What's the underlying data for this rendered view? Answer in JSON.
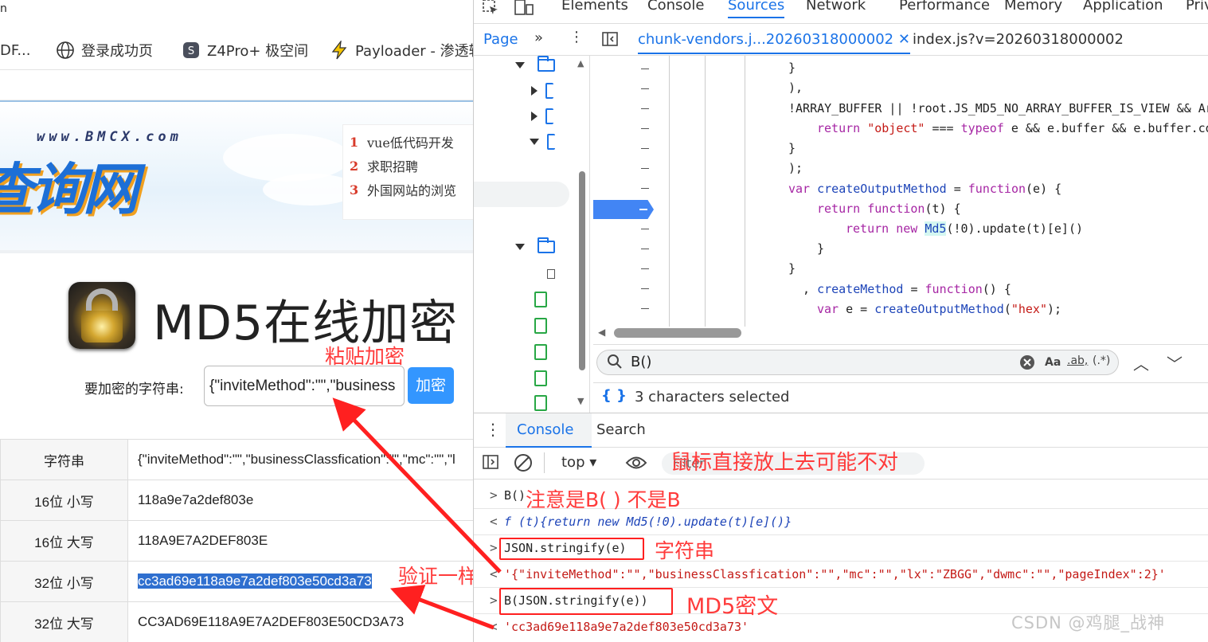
{
  "browser": {
    "top_fragment": "n",
    "bookmarks": [
      {
        "label": "DF...",
        "icon": "none"
      },
      {
        "label": "登录成功页",
        "icon": "globe-icon"
      },
      {
        "label": "Z4Pro+ 极空间",
        "icon": "shield-icon"
      },
      {
        "label": "Payloader - 渗透辅",
        "icon": "lightning-icon"
      }
    ]
  },
  "site": {
    "url_text": "www.BMCX.com",
    "name": "查询网",
    "hot_links": [
      {
        "num": "1",
        "label": "vue低代码开发"
      },
      {
        "num": "2",
        "label": "求职招聘"
      },
      {
        "num": "3",
        "label": "外国网站的浏览"
      }
    ],
    "page_title": "MD5在线加密",
    "form_label": "要加密的字符串:",
    "input_value": "{\"inviteMethod\":\"\",\"business",
    "encrypt_button": "加密",
    "results": [
      {
        "key": "字符串",
        "value": "{\"inviteMethod\":\"\",\"businessClassfication\":\"\",\"mc\":\"\",\"l"
      },
      {
        "key": "16位 小写",
        "value": "118a9e7a2def803e"
      },
      {
        "key": "16位 大写",
        "value": "118A9E7A2DEF803E"
      },
      {
        "key": "32位 小写",
        "value": "cc3ad69e118a9e7a2def803e50cd3a73"
      },
      {
        "key": "32位 大写",
        "value": "CC3AD69E118A9E7A2DEF803E50CD3A73"
      }
    ]
  },
  "devtools": {
    "tabs": [
      "Elements",
      "Console",
      "Sources",
      "Network",
      "Performance",
      "Memory",
      "Application",
      "Priv"
    ],
    "active_tab": "Sources",
    "sources": {
      "page_tab": "Page",
      "file_tabs": [
        "chunk-vendors.j...20260318000002",
        "index.js?v=20260318000002"
      ],
      "code_lines": [
        "}",
        "),",
        "!ARRAY_BUFFER || !root.JS_MD5_NO_ARRAY_BUFFER_IS_VIEW && Ar",
        "return \"object\" === typeof e && e.buffer && e.buffer.co",
        "}",
        ");",
        "var createOutputMethod = function(e) {",
        "return function(t) {",
        "return new Md5(!0).update(t)[e]()",
        "}",
        "}",
        ", createMethod = function() {",
        "var e = createOutputMethod(\"hex\");"
      ],
      "search_query": "B()",
      "search_options": [
        "Aa",
        ".ab,",
        "(.*)"
      ],
      "selection_info": "3 characters selected"
    },
    "drawer_tabs": [
      "Console",
      "Search"
    ],
    "console": {
      "context": "top",
      "filter_placeholder": "Filter",
      "lines": [
        {
          "arrow": ">",
          "text": "B()"
        },
        {
          "arrow": "<",
          "text": "f (t){return new Md5(!0).update(t)[e]()}"
        },
        {
          "arrow": ">",
          "text": "JSON.stringify(e)"
        },
        {
          "arrow": "<",
          "text": "'{\"inviteMethod\":\"\",\"businessClassfication\":\"\",\"mc\":\"\",\"lx\":\"ZBGG\",\"dwmc\":\"\",\"pageIndex\":2}'"
        },
        {
          "arrow": ">",
          "text": "B(JSON.stringify(e))"
        },
        {
          "arrow": "<",
          "text": "'cc3ad69e118a9e7a2def803e50cd3a73'"
        }
      ]
    }
  },
  "annotations": {
    "paste_encrypt": "粘贴加密",
    "verify_same": "验证一样",
    "mouse_hover_warning": "鼠标直接放上去可能不对",
    "note_b_call": "注意是B( )  不是B",
    "string_label": "字符串",
    "md5_cipher": "MD5密文"
  },
  "watermark": "CSDN @鸡腿_战神",
  "colors": {
    "accent_blue": "#1a73e8",
    "annotation_red": "#ff2020",
    "button_blue": "#3396ff",
    "selection_blue": "#2f6fcf"
  }
}
